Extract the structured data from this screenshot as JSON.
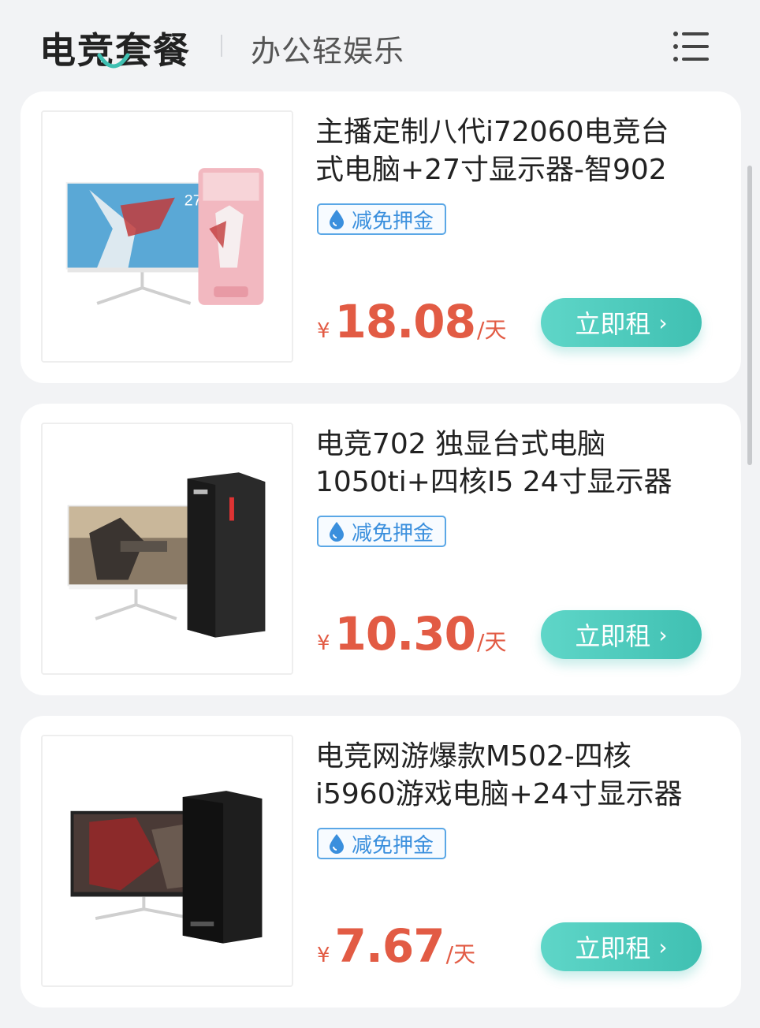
{
  "header": {
    "active_tab": "电竞套餐",
    "inactive_tab": "办公轻娱乐",
    "menu_icon": "hamburger-menu-icon",
    "accent_color": "#3fc0b2"
  },
  "products": [
    {
      "title_line1": "主播定制八代i72060电竞台",
      "title_line2": "式电脑+27寸显示器-智902",
      "badge": "减免押金",
      "currency": "¥",
      "price": "18.08",
      "unit": "/天",
      "button": "立即租",
      "monitor_label": "27\""
    },
    {
      "title_line1": "电竞702 独显台式电脑",
      "title_line2": "1050ti+四核I5 24寸显示器",
      "badge": "减免押金",
      "currency": "¥",
      "price": "10.30",
      "unit": "/天",
      "button": "立即租"
    },
    {
      "title_line1": "电竞网游爆款M502-四核",
      "title_line2": "i5960游戏电脑+24寸显示器",
      "badge": "减免押金",
      "currency": "¥",
      "price": "7.67",
      "unit": "/天",
      "button": "立即租"
    }
  ],
  "colors": {
    "price": "#e25b44",
    "badge": "#3a8fdd",
    "button": "#3fc0b2"
  }
}
